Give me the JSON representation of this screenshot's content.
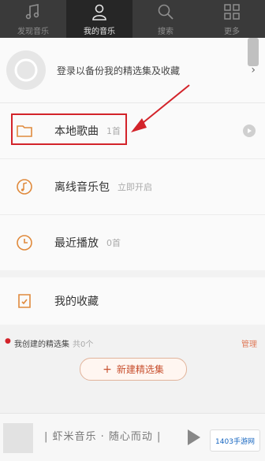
{
  "nav": {
    "tabs": [
      {
        "label": "发现音乐",
        "icon": "music-note-icon",
        "active": false
      },
      {
        "label": "我的音乐",
        "icon": "person-icon",
        "active": true
      },
      {
        "label": "搜索",
        "icon": "search-icon",
        "active": false
      },
      {
        "label": "更多",
        "icon": "grid-icon",
        "active": false
      }
    ]
  },
  "login": {
    "text": "登录以备份我的精选集及收藏"
  },
  "list": [
    {
      "label": "本地歌曲",
      "meta": "1首",
      "icon": "folder-icon"
    },
    {
      "label": "离线音乐包",
      "meta": "立即开启",
      "icon": "music-disc-icon"
    },
    {
      "label": "最近播放",
      "meta": "0首",
      "icon": "clock-icon"
    }
  ],
  "favorites": {
    "label": "我的收藏",
    "icon": "favorites-icon"
  },
  "section": {
    "title": "我创建的精选集",
    "count": "共0个",
    "manage": "管理"
  },
  "new_button": {
    "label": "新建精选集"
  },
  "player": {
    "now_playing": "| 虾米音乐 · 随心而动 |",
    "watermark": "1403手游网"
  },
  "colors": {
    "accent": "#d3232a",
    "orange": "#e08a3c",
    "nav_bg": "#3a3a3a"
  }
}
